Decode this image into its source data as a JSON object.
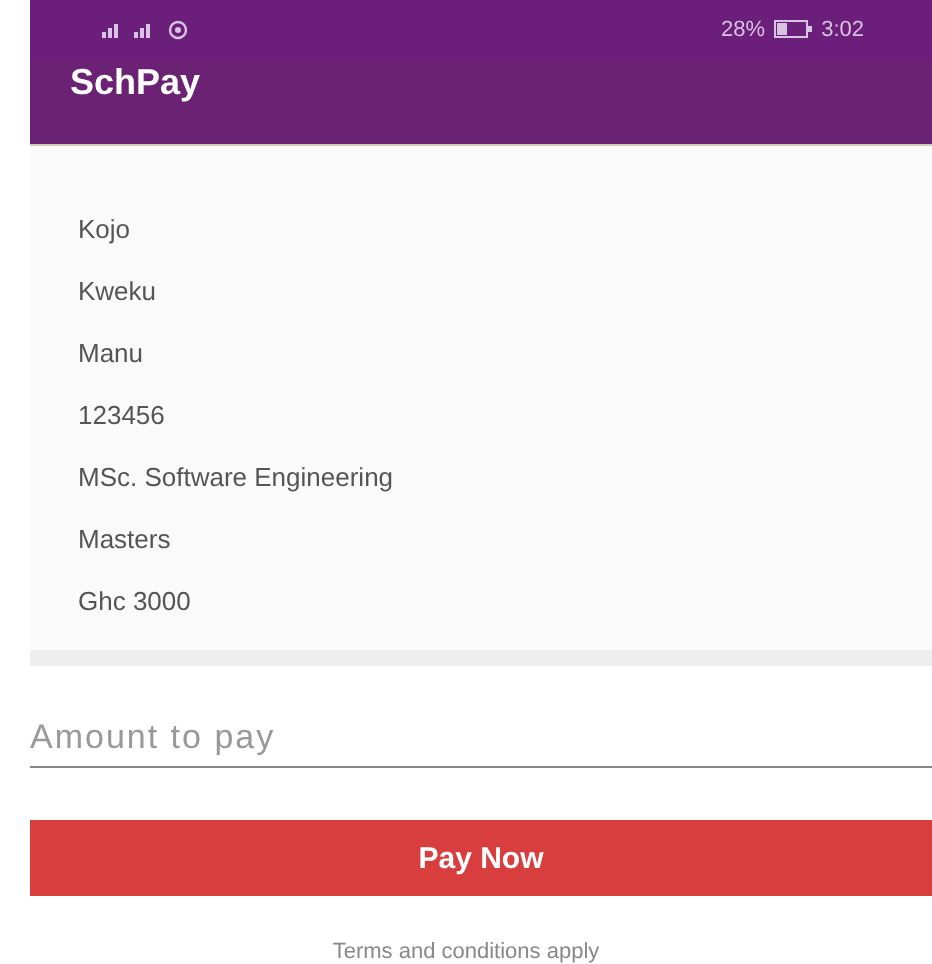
{
  "status_bar": {
    "battery": "28%",
    "time": "3:02"
  },
  "app_bar": {
    "title": "SchPay"
  },
  "details": [
    "Kojo",
    "Kweku",
    "Manu",
    "123456",
    "MSc. Software Engineering",
    "Masters",
    "Ghc 3000"
  ],
  "amount_field": {
    "placeholder": "Amount to pay"
  },
  "pay_button": {
    "label": "Pay Now"
  },
  "footer": {
    "text": "Terms and conditions apply"
  }
}
